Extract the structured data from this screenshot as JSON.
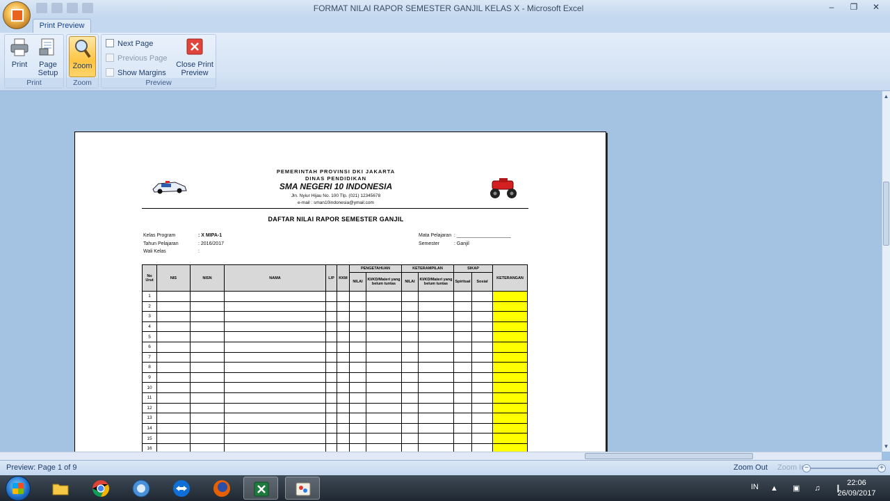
{
  "window": {
    "title": "FORMAT NILAI RAPOR SEMESTER GANJIL KELAS X - Microsoft Excel",
    "controls": [
      "–",
      "❐",
      "✕"
    ]
  },
  "ribbon": {
    "active_tab": "Print Preview",
    "groups": {
      "print": {
        "label": "Print",
        "print_btn": "Print",
        "page_setup_line1": "Page",
        "page_setup_line2": "Setup"
      },
      "zoom": {
        "label": "Zoom",
        "zoom_btn": "Zoom"
      },
      "preview": {
        "label": "Preview",
        "next_page": "Next Page",
        "previous_page": "Previous Page",
        "show_margins": "Show Margins",
        "close_line1": "Close Print",
        "close_line2": "Preview"
      }
    }
  },
  "document": {
    "header": {
      "line1": "PEMERINTAH PROVINSI DKI JAKARTA",
      "line2": "DINAS PENDIDIKAN",
      "school": "SMA NEGERI 10 INDONESIA",
      "address": "Jln. Nyiur Hijau No. 100 Tlp. (021) 12345678",
      "email": "e-mail : sman10indonesia@ymail.com"
    },
    "title": "DAFTAR NILAI RAPOR SEMESTER GANJIL",
    "meta": {
      "kelas_label": "Kelas Program",
      "kelas_value": ": X MIPA-1",
      "tahun_label": "Tahun Pelajaran",
      "tahun_value": ": 2016/2017",
      "wali_label": "Wali Kelas",
      "wali_value": ":",
      "mapel_label": "Mata Pelajaran",
      "mapel_value": ": ____________________",
      "semester_label": "Semester",
      "semester_value": ": Ganjil"
    },
    "table": {
      "headers": {
        "no": "No Urut",
        "nis": "NIS",
        "nisn": "NISN",
        "nama": "NAMA",
        "lp": "L/P",
        "kkm": "KKM",
        "pengetahuan": "PENGETAHUAN",
        "keterampilan": "KETERAMPILAN",
        "sikap": "SIKAP",
        "keterangan": "KETERANGAN",
        "nilai": "NILAI",
        "kikd": "KI/KD/Materi yang belum tuntas",
        "spiritual": "Spiritual",
        "sosial": "Sosial"
      },
      "rows": [
        "1",
        "2",
        "3",
        "4",
        "5",
        "6",
        "7",
        "8",
        "9",
        "10",
        "11",
        "12",
        "13",
        "14",
        "15",
        "16"
      ]
    }
  },
  "statusbar": {
    "left": "Preview: Page 1 of 9",
    "zoom_out": "Zoom Out",
    "zoom_in": "Zoom In",
    "minus": "−",
    "plus": "+"
  },
  "taskbar": {
    "lang": "IN",
    "tray": "▲ ▣ ♫ ❙",
    "time": "22:06",
    "date": "26/09/2017"
  }
}
